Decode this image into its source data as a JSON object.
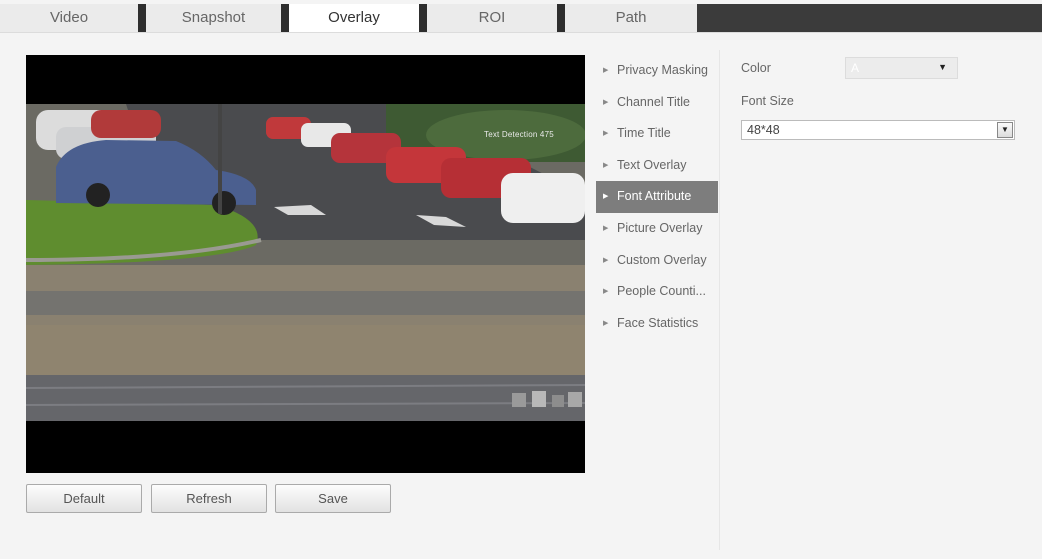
{
  "tabs": [
    {
      "label": "Video",
      "active": false
    },
    {
      "label": "Snapshot",
      "active": false
    },
    {
      "label": "Overlay",
      "active": true
    },
    {
      "label": "ROI",
      "active": false
    },
    {
      "label": "Path",
      "active": false
    }
  ],
  "video": {
    "osd_text": "Text Detection 475"
  },
  "buttons": {
    "default_label": "Default",
    "refresh_label": "Refresh",
    "save_label": "Save"
  },
  "menu": {
    "items": [
      {
        "label": "Privacy Masking",
        "active": false
      },
      {
        "label": "Channel Title",
        "active": false
      },
      {
        "label": "Time Title",
        "active": false
      },
      {
        "label": "Text Overlay",
        "active": false
      },
      {
        "label": "Font Attribute",
        "active": true
      },
      {
        "label": "Picture Overlay",
        "active": false
      },
      {
        "label": "Custom Overlay",
        "active": false
      },
      {
        "label": "People Counti...",
        "active": false
      },
      {
        "label": "Face Statistics",
        "active": false
      }
    ],
    "arrow_glyph": "▶"
  },
  "settings": {
    "color_label": "Color",
    "color_value": "A",
    "font_size_label": "Font Size",
    "font_size_value": "48*48",
    "dropdown_glyph": "▼"
  },
  "colors": {
    "active_tab_bg": "#ffffff",
    "tab_separator": "#2e2e2e",
    "menu_active_bg": "#7d7d7d"
  }
}
